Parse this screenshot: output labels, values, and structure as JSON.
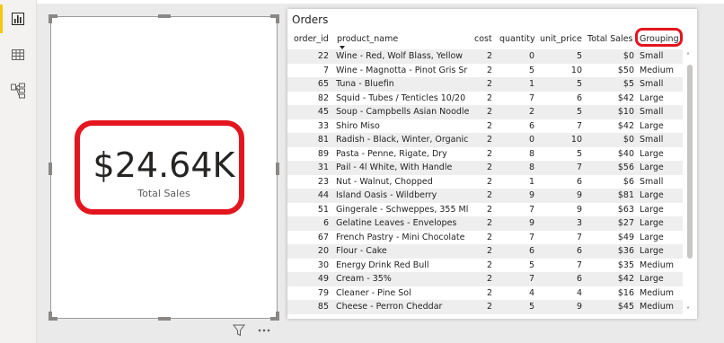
{
  "rail": {
    "items": [
      {
        "name": "report-view",
        "active": true
      },
      {
        "name": "data-view",
        "active": false
      },
      {
        "name": "model-view",
        "active": false
      }
    ],
    "accent": "#f2c811"
  },
  "card": {
    "value": "$24.64K",
    "label": "Total Sales",
    "highlight_color": "#e3151e"
  },
  "table": {
    "title": "Orders",
    "columns": {
      "order_id": "order_id",
      "product_name": "product_name",
      "cost": "cost",
      "quantity": "quantity",
      "unit_price": "unit_price",
      "total_sales": "Total Sales",
      "grouping": "Grouping"
    },
    "rows": [
      [
        "22",
        "Wine - Red, Wolf Blass, Yellow",
        "2",
        "0",
        "5",
        "$0",
        "Small"
      ],
      [
        "7",
        "Wine - Magnotta - Pinot Gris Sr",
        "2",
        "5",
        "10",
        "$50",
        "Medium"
      ],
      [
        "65",
        "Tuna - Bluefin",
        "2",
        "1",
        "5",
        "$5",
        "Small"
      ],
      [
        "82",
        "Squid - Tubes / Tenticles 10/20",
        "2",
        "7",
        "6",
        "$42",
        "Large"
      ],
      [
        "45",
        "Soup - Campbells Asian Noodle",
        "2",
        "2",
        "5",
        "$10",
        "Small"
      ],
      [
        "33",
        "Shiro Miso",
        "2",
        "6",
        "7",
        "$42",
        "Large"
      ],
      [
        "81",
        "Radish - Black, Winter, Organic",
        "2",
        "0",
        "10",
        "$0",
        "Small"
      ],
      [
        "89",
        "Pasta - Penne, Rigate, Dry",
        "2",
        "8",
        "5",
        "$40",
        "Large"
      ],
      [
        "31",
        "Pail - 4l White, With Handle",
        "2",
        "8",
        "7",
        "$56",
        "Large"
      ],
      [
        "23",
        "Nut - Walnut, Chopped",
        "2",
        "1",
        "6",
        "$6",
        "Small"
      ],
      [
        "44",
        "Island Oasis - Wildberry",
        "2",
        "9",
        "9",
        "$81",
        "Large"
      ],
      [
        "51",
        "Gingerale - Schweppes, 355 Ml",
        "2",
        "7",
        "9",
        "$63",
        "Large"
      ],
      [
        "6",
        "Gelatine Leaves - Envelopes",
        "2",
        "9",
        "3",
        "$27",
        "Large"
      ],
      [
        "67",
        "French Pastry - Mini Chocolate",
        "2",
        "7",
        "7",
        "$49",
        "Large"
      ],
      [
        "20",
        "Flour - Cake",
        "2",
        "6",
        "6",
        "$36",
        "Large"
      ],
      [
        "30",
        "Energy Drink Red Bull",
        "2",
        "5",
        "7",
        "$35",
        "Medium"
      ],
      [
        "49",
        "Cream - 35%",
        "2",
        "7",
        "6",
        "$42",
        "Large"
      ],
      [
        "79",
        "Cleaner - Pine Sol",
        "2",
        "4",
        "4",
        "$16",
        "Medium"
      ],
      [
        "85",
        "Cheese - Perron Cheddar",
        "2",
        "5",
        "9",
        "$45",
        "Medium"
      ]
    ]
  },
  "footer_icons": [
    "filter-icon",
    "more-options-icon"
  ]
}
